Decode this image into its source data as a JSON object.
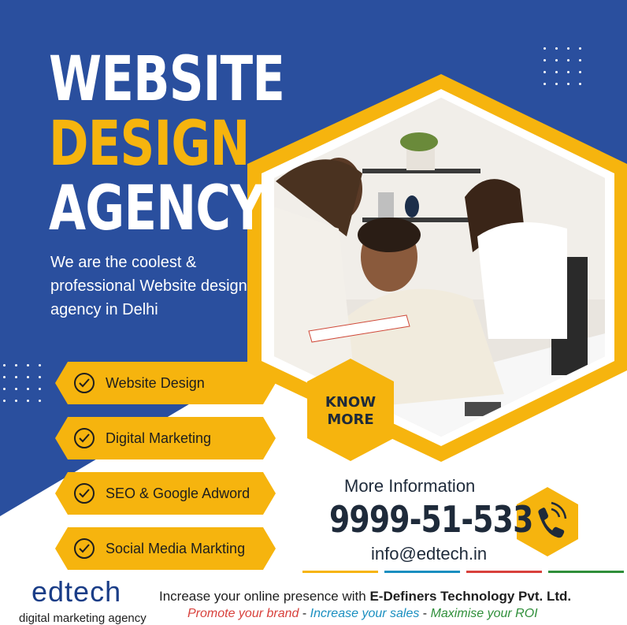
{
  "headline": {
    "line1": "WEBSITE",
    "line2": "DESIGN",
    "line3": "AGENCY"
  },
  "tagline": "We are the coolest & professional Website design agency in Delhi",
  "services": [
    {
      "label": "Website Design"
    },
    {
      "label": "Digital Marketing"
    },
    {
      "label": "SEO & Google Adword"
    },
    {
      "label": "Social Media Markting"
    }
  ],
  "cta": {
    "line1": "KNOW",
    "line2": "MORE"
  },
  "contact": {
    "heading": "More Information",
    "phone": "9999-51-533",
    "email": "info@edtech.in",
    "icon": "phone-icon"
  },
  "brand": {
    "name": "edtech",
    "subtitle": "digital marketing agency"
  },
  "footer": {
    "line1_prefix": "Increase your online presence with ",
    "line1_company": "E-Definers Technology Pvt.  Ltd.",
    "slogan_part1": "Promote your brand",
    "separator": " - ",
    "slogan_part2": "Increase your sales",
    "slogan_part3": "Maximise your ROI"
  },
  "colors": {
    "blue": "#2a4f9e",
    "yellow": "#f6b40e",
    "dark": "#1e2a3a",
    "red": "#d8413c",
    "teal": "#1a8fc0",
    "green": "#2f8f3a"
  }
}
